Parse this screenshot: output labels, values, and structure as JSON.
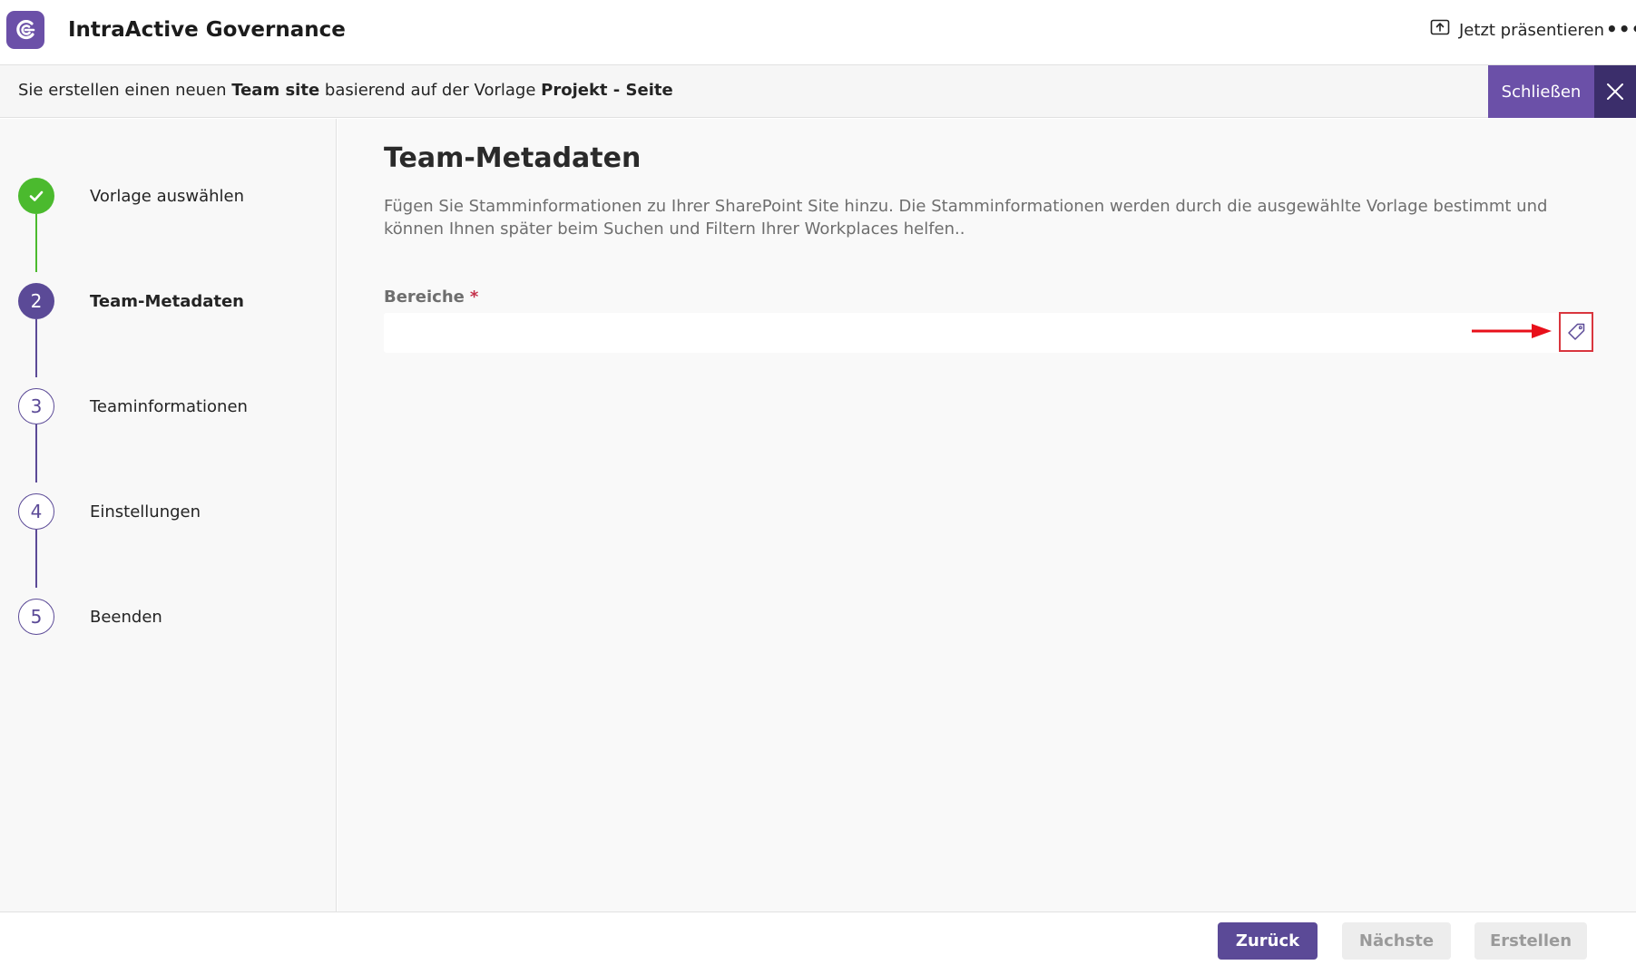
{
  "app": {
    "title": "IntraActive Governance",
    "present_label": "Jetzt präsentieren",
    "more_label": "•••"
  },
  "banner": {
    "prefix": "Sie erstellen einen neuen ",
    "site_type": "Team site",
    "middle": " basierend auf der Vorlage ",
    "template_name": "Projekt - Seite",
    "close_label": "Schließen"
  },
  "stepper": {
    "steps": [
      {
        "number": "1",
        "label": "Vorlage auswählen",
        "state": "done"
      },
      {
        "number": "2",
        "label": "Team-Metadaten",
        "state": "active"
      },
      {
        "number": "3",
        "label": "Teaminformationen",
        "state": "todo"
      },
      {
        "number": "4",
        "label": "Einstellungen",
        "state": "todo"
      },
      {
        "number": "5",
        "label": "Beenden",
        "state": "todo"
      }
    ]
  },
  "main": {
    "title": "Team-Metadaten",
    "description": "Fügen Sie Stamminformationen zu Ihrer SharePoint Site hinzu. Die Stamminformationen werden durch die ausgewählte Vorlage bestimmt und können Ihnen später beim Suchen und Filtern Ihrer Workplaces helfen..",
    "field": {
      "label": "Bereiche",
      "required_mark": "*",
      "value": "",
      "icon": "tag-icon"
    }
  },
  "footer": {
    "back_label": "Zurück",
    "next_label": "Nächste",
    "create_label": "Erstellen"
  },
  "colors": {
    "brand": "#6b50a8",
    "brand_dark": "#3b2e6b",
    "step_active": "#5b4a97",
    "step_done": "#4bba2e",
    "annotation": "#d9363e"
  }
}
